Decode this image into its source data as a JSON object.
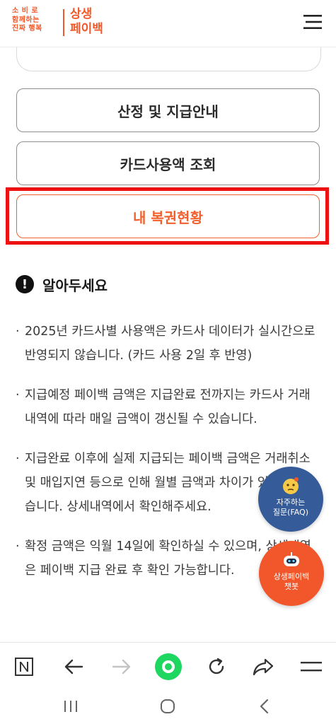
{
  "header": {
    "logo_small_lines": [
      "소 비 로",
      "함께하는",
      "진짜 행복"
    ],
    "logo_big_lines": [
      "상생",
      "페이백"
    ]
  },
  "buttons": {
    "selection_guide": "산정 및 지급안내",
    "card_usage_lookup": "카드사용액 조회",
    "my_recovery_status": "내 복권현황"
  },
  "notice": {
    "title": "알아두세요",
    "items": [
      "2025년 카드사별 사용액은 카드사 데이터가 실시간으로 반영되지 않습니다. (카드 사용 2일 후 반영)",
      "지급예정 페이백 금액은 지급완료 전까지는 카드사 거래내역에 따라 매일 금액이 갱신될 수 있습니다.",
      "지급완료 이후에 실제 지급되는 페이백 금액은 거래취소 및 매입지연 등으로 인해 월별 금액과 차이가 있을 수 있습니다. 상세내역에서 확인해주세요.",
      "확정 금액은 익월 14일에 확인하실 수 있으며, 상세내역은 페이백 지급 완료 후 확인 가능합니다."
    ]
  },
  "floating": {
    "faq_line1": "자주하는",
    "faq_line2": "질문(FAQ)",
    "chat_line1": "상생페이백",
    "chat_line2": "챗봇"
  },
  "colors": {
    "brand_orange": "#f2592a",
    "highlight_red": "#ee1111",
    "faq_blue": "#355b98",
    "home_green": "#1ed760"
  },
  "icons": {
    "toolbar": [
      "naver-n-icon",
      "back-arrow-icon",
      "forward-arrow-icon",
      "home-green-icon",
      "refresh-icon",
      "share-icon",
      "menu-icon"
    ],
    "system_nav": [
      "recent-apps-icon",
      "home-circle-icon",
      "back-chevron-icon"
    ]
  }
}
